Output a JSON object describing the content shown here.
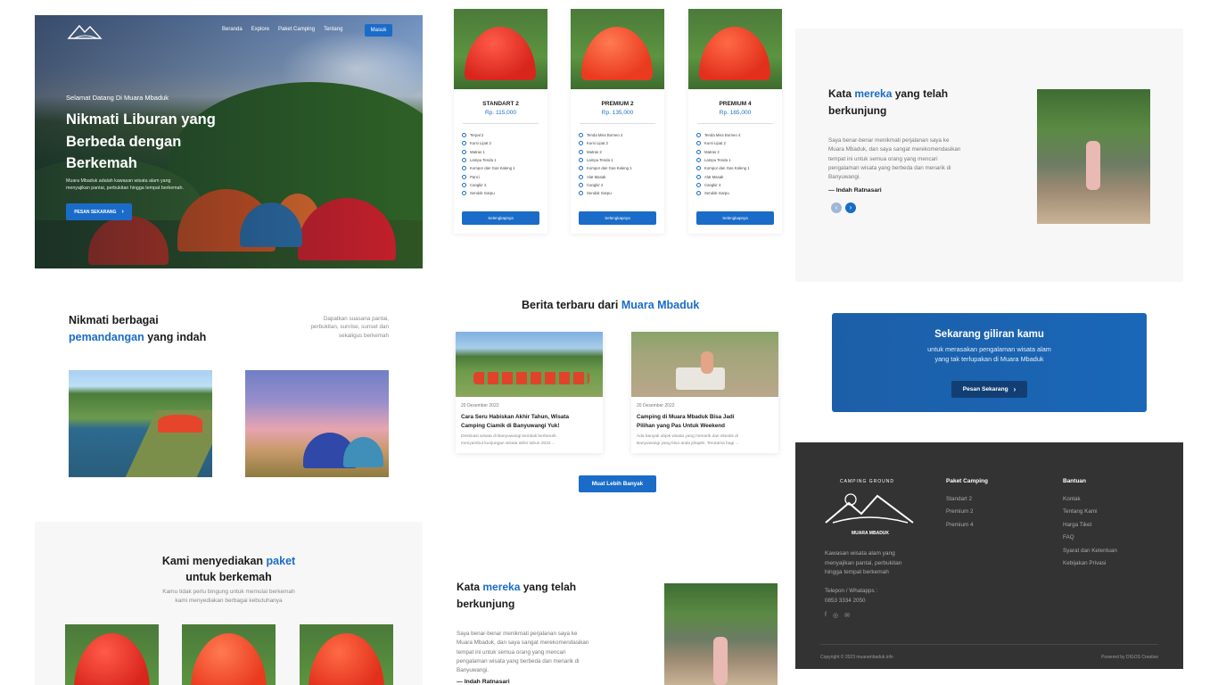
{
  "hero": {
    "nav": [
      "Beranda",
      "Explore",
      "Paket Camping",
      "Tentang"
    ],
    "login": "Masuk",
    "welcome": "Selamat Datang Di Muara Mbaduk",
    "title_lines": [
      "Nikmati Liburan yang",
      "Berbeda dengan",
      "Berkemah"
    ],
    "desc_lines": [
      "Muara Mbaduk adalah kawasan wisata alam yang",
      "menyajikan pantai, perbukitan hingga tempat berkemah."
    ],
    "cta": "PESAN SEKARANG"
  },
  "packages": [
    {
      "name": "STANDART 2",
      "price": "Rp. 115,000",
      "items": [
        "Terpal 2",
        "Kursi Lipat 2",
        "Matras 1",
        "Lampu Tenda 1",
        "Kompor dan Gas Kaleng 1",
        "Panci",
        "Cangkir 2",
        "Sendok Garpu"
      ]
    },
    {
      "name": "PREMIUM 2",
      "price": "Rp. 135,000",
      "items": [
        "Tenda Miss Borneo 2",
        "Kursi Lipat 2",
        "Matras 2",
        "Lampu Tenda 1",
        "Kompor dan Gas Kaleng 1",
        "Alat Masak",
        "Cangkir 2",
        "Sendok Garpu"
      ]
    },
    {
      "name": "PREMIUM 4",
      "price": "Rp. 165,000",
      "items": [
        "Tenda Miss Borneo 4",
        "Kursi Lipat 2",
        "Matras 2",
        "Lampu Tenda 1",
        "Kompor dan Gas Kaleng 1",
        "Alat Masak",
        "Cangkir 4",
        "Sendok Garpu"
      ]
    }
  ],
  "package_button": "Selengkapnya",
  "testimonial": {
    "title_a": "Kata ",
    "title_b": "mereka",
    "title_c": " yang telah",
    "title_d": "berkunjung",
    "text_lines": [
      "Saya benar-benar menikmati perjalanan saya ke",
      "Muara Mbaduk, dan saya sangat  merekomendasikan",
      "tempat ini untuk semua orang yang mencari",
      "pengalaman wisata yang berbeda dan menarik di",
      "Banyuwangi."
    ],
    "author": "Indah Ratnasari",
    "author_partial": "Indah Ratnasari"
  },
  "views": {
    "title_a": "Nikmati berbagai",
    "title_b": "pemandangan",
    "title_c": " yang indah",
    "desc_lines": [
      "Dapatkan suasana pantai,",
      "perbukitan, sunrise, sunset dan",
      "sekaligus berkemah"
    ]
  },
  "news": {
    "title_a": "Berita terbaru dari ",
    "title_b": "Muara Mbaduk",
    "items": [
      {
        "date": "20 Desember 2022",
        "headline_lines": [
          "Cara Seru Habiskan Akhir Tahun, Wisata",
          "Camping Ciamik di Banyuwangi Yuk!"
        ],
        "excerpt_lines": [
          "Destinasi wisata di Banyuwangi kembali berbenah",
          "menyambut kunjungan wisata akhir tahun 2022 ..."
        ]
      },
      {
        "date": "20 Desember 2022",
        "headline_lines": [
          "Camping di Muara Mbaduk Bisa Jadi",
          "Pilihan yang Pas Untuk  Weekend"
        ],
        "excerpt_lines": [
          "Ada banyak objek wisata yang menarik dan eksotis di",
          "Banyuwangi yang bisa anda jelajahi. Terutama bagi ..."
        ]
      }
    ],
    "more": "Muat Lebih Banyak"
  },
  "cta": {
    "title": "Sekarang giliran kamu",
    "sub_lines": [
      "untuk merasakan pengalaman wisata alam",
      "yang tak terlupakan di Muara Mbaduk"
    ],
    "button": "Pesan Sekarang"
  },
  "offer": {
    "title_a": "Kami menyediakan ",
    "title_b": "paket",
    "title_c": "untuk berkemah",
    "desc_lines": [
      "Kamu tidak perlu bingung untuk memulai berkemah",
      "kami menyediakan berbagai kebutuhanya"
    ]
  },
  "footer": {
    "logo_top": "CAMPING GROUND",
    "logo_bottom": "MUARA MBADUK",
    "about_lines": [
      "Kawasan wisata alam yang",
      "menyajikan pantai, perbukitan",
      "hingga tempat berkemah"
    ],
    "phone_label": "Telepon / Whatapps :",
    "phone": "0853 3334 2050",
    "col1_title": "Paket Camping",
    "col1": [
      "Standart 2",
      "Premium 2",
      "Premium 4"
    ],
    "col2_title": "Bantuan",
    "col2": [
      "Kontak",
      "Tentang Kami",
      "Harga Tiket",
      "FAQ",
      "Syarat dan Ketentuan",
      "Kebijakan Privasi"
    ],
    "copyright": "Copyright © 2023 muarambaduk.info",
    "powered": "Powered by DIGOS Creative"
  },
  "colors": {
    "accent": "#1a6cc8",
    "footer_bg": "#333333",
    "cta_bg": "#1c5fa8"
  }
}
